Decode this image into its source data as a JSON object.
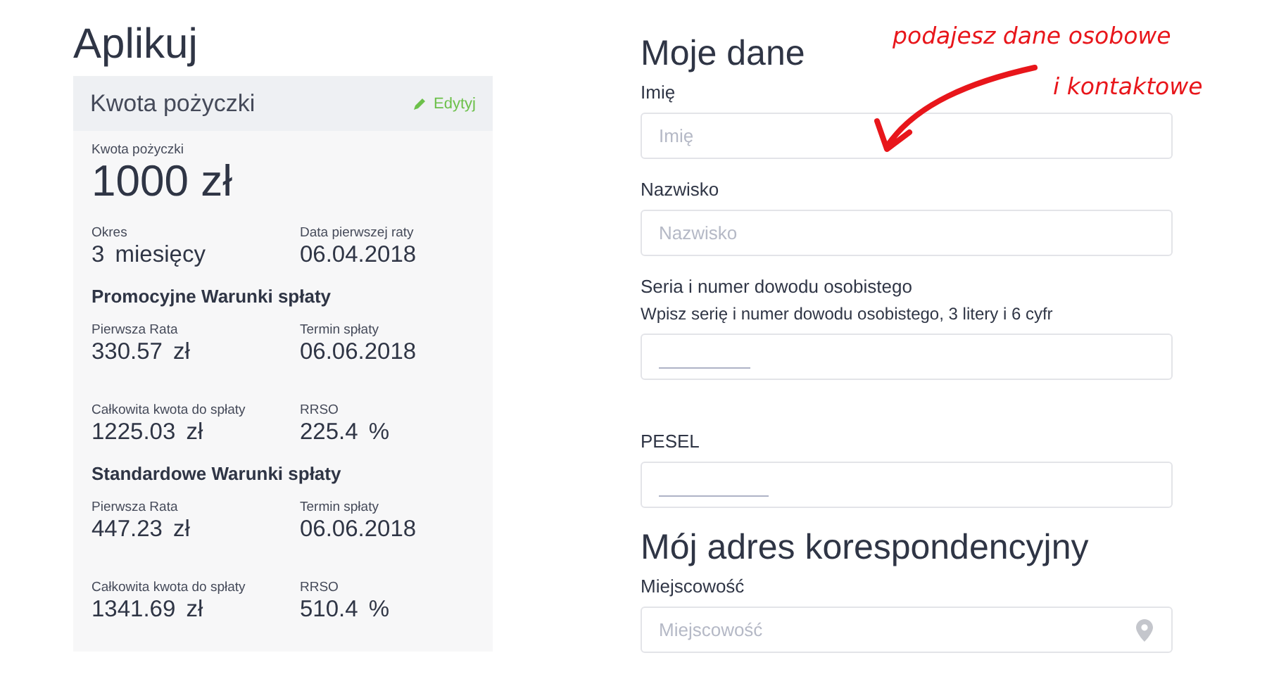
{
  "page_title": "Aplikuj",
  "loan": {
    "title": "Kwota pożyczki",
    "edit_label": "Edytyj",
    "amount_label": "Kwota pożyczki",
    "amount": "1000 zł",
    "items": [
      {
        "kind": "pair",
        "cells": [
          {
            "label": "Okres",
            "value": "3 miesięcy"
          },
          {
            "label": "Data pierwszej raty",
            "value": "06.04.2018"
          }
        ]
      },
      {
        "kind": "heading",
        "text": "Promocyjne Warunki spłaty"
      },
      {
        "kind": "pair",
        "cells": [
          {
            "label": "Pierwsza Rata",
            "value": "330.57 zł"
          },
          {
            "label": "Termin spłaty",
            "value": "06.06.2018"
          }
        ]
      },
      {
        "kind": "pair",
        "cells": [
          {
            "label": "Całkowita kwota do spłaty",
            "value": "1225.03 zł"
          },
          {
            "label": "RRSO",
            "value": "225.4 %"
          }
        ]
      },
      {
        "kind": "heading",
        "text": "Standardowe Warunki spłaty"
      },
      {
        "kind": "pair",
        "cells": [
          {
            "label": "Pierwsza Rata",
            "value": "447.23 zł"
          },
          {
            "label": "Termin spłaty",
            "value": "06.06.2018"
          }
        ]
      },
      {
        "kind": "pair",
        "cells": [
          {
            "label": "Całkowita kwota do spłaty",
            "value": "1341.69 zł"
          },
          {
            "label": "RRSO",
            "value": "510.4 %"
          }
        ]
      }
    ]
  },
  "form": [
    {
      "kind": "heading",
      "text": "Moje dane"
    },
    {
      "kind": "text",
      "label": "Imię",
      "placeholder": "Imię"
    },
    {
      "kind": "text",
      "label": "Nazwisko",
      "placeholder": "Nazwisko"
    },
    {
      "kind": "masked",
      "label": "Seria i numer dowodu osobistego",
      "hint": "Wpisz serię i numer dowodu osobistego, 3 litery i 6 cyfr"
    },
    {
      "kind": "masked",
      "label": "PESEL"
    },
    {
      "kind": "heading",
      "text": "Mój adres korespondencyjny"
    },
    {
      "kind": "location",
      "label": "Miejscowość",
      "placeholder": "Miejscowość"
    }
  ],
  "annotation": {
    "lines": [
      "podajesz dane osobowe",
      "i kontaktowe"
    ]
  }
}
